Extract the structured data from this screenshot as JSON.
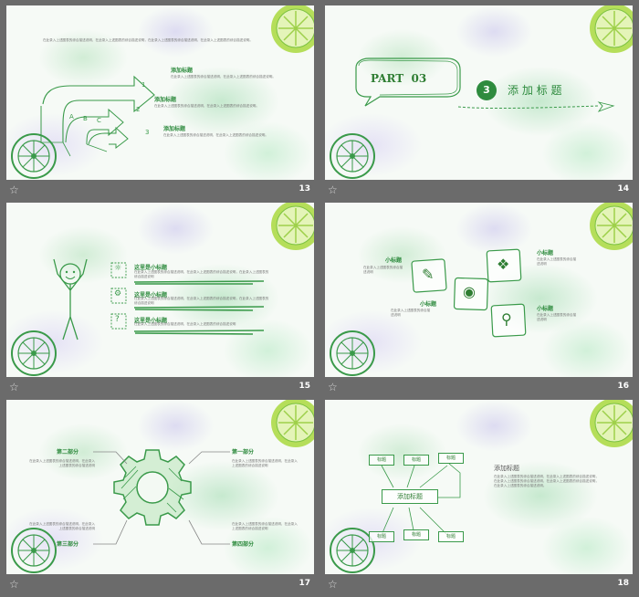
{
  "slides": [
    {
      "page": "13",
      "intro_text": "在此录入上述图表的综合描述说明，在此录入上述图表的综合描述说明，在此录入上述图表的综合描述说明，在此录入上述图表的综合描述说明。",
      "abc_letters": [
        "A",
        "B",
        "C"
      ],
      "numbers": [
        "1",
        "2",
        "3"
      ],
      "items": [
        {
          "title": "添加标题",
          "text": "在此录入上述图表的综合描述说明，在此录入上述图表的综合描述说明。"
        },
        {
          "title": "添加标题",
          "text": "在此录入上述图表的综合描述说明，在此录入上述图表的综合描述说明。"
        },
        {
          "title": "添加标题",
          "text": "在此录入上述图表的综合描述说明，在此录入上述图表的综合描述说明。"
        }
      ]
    },
    {
      "page": "14",
      "part_label": "PART  03",
      "section_number": "3",
      "section_title": "添 加 标 题"
    },
    {
      "page": "15",
      "items": [
        {
          "title": "这里是小标题",
          "text": "在此录入上述图表的综合描述说明，在此录入上述图表的综合描述说明，在此录入上述图表的综合描述说明"
        },
        {
          "title": "这里是小标题",
          "text": "在此录入上述图表的综合描述说明，在此录入上述图表的综合描述说明，在此录入上述图表的综合描述说明"
        },
        {
          "title": "这里是小标题",
          "text": "在此录入上述图表的综合描述说明，在此录入上述图表的综合描述说明"
        }
      ]
    },
    {
      "page": "16",
      "labels": [
        {
          "title": "小标题",
          "text": "在此录入上述图表的综合描述说明"
        },
        {
          "title": "小标题",
          "text": "在此录入上述图表的综合描述说明"
        },
        {
          "title": "小标题",
          "text": "在此录入上述图表的综合描述说明"
        },
        {
          "title": "小标题",
          "text": "在此录入上述图表的综合描述说明"
        }
      ]
    },
    {
      "page": "17",
      "parts": [
        {
          "title": "第二部分",
          "text": "在此录入上述图表的综合描述说明，在此录入上述图表的综合描述说明"
        },
        {
          "title": "第一部分",
          "text": "在此录入上述图表的综合描述说明，在此录入上述图表的综合描述说明"
        },
        {
          "title": "第三部分",
          "text": "在此录入上述图表的综合描述说明，在此录入上述图表的综合描述说明"
        },
        {
          "title": "第四部分",
          "text": "在此录入上述图表的综合描述说明，在此录入上述图表的综合描述说明"
        }
      ]
    },
    {
      "page": "18",
      "center_label": "添加标题",
      "box_label": "标题",
      "side_title": "添加标题",
      "side_text": "在此录入上述图表的综合描述说明，在此录入上述图表的综合描述说明，在此录入上述图表的综合描述说明，在此录入上述图表的综合描述说明，在此录入上述图表的综合描述说明。"
    }
  ],
  "footer_icon": "star-outline-icon",
  "colors": {
    "accent": "#2e8b3e",
    "lime": "#b5de5a",
    "lime_dark": "#7cc242",
    "frame": "#6b6b6b"
  }
}
